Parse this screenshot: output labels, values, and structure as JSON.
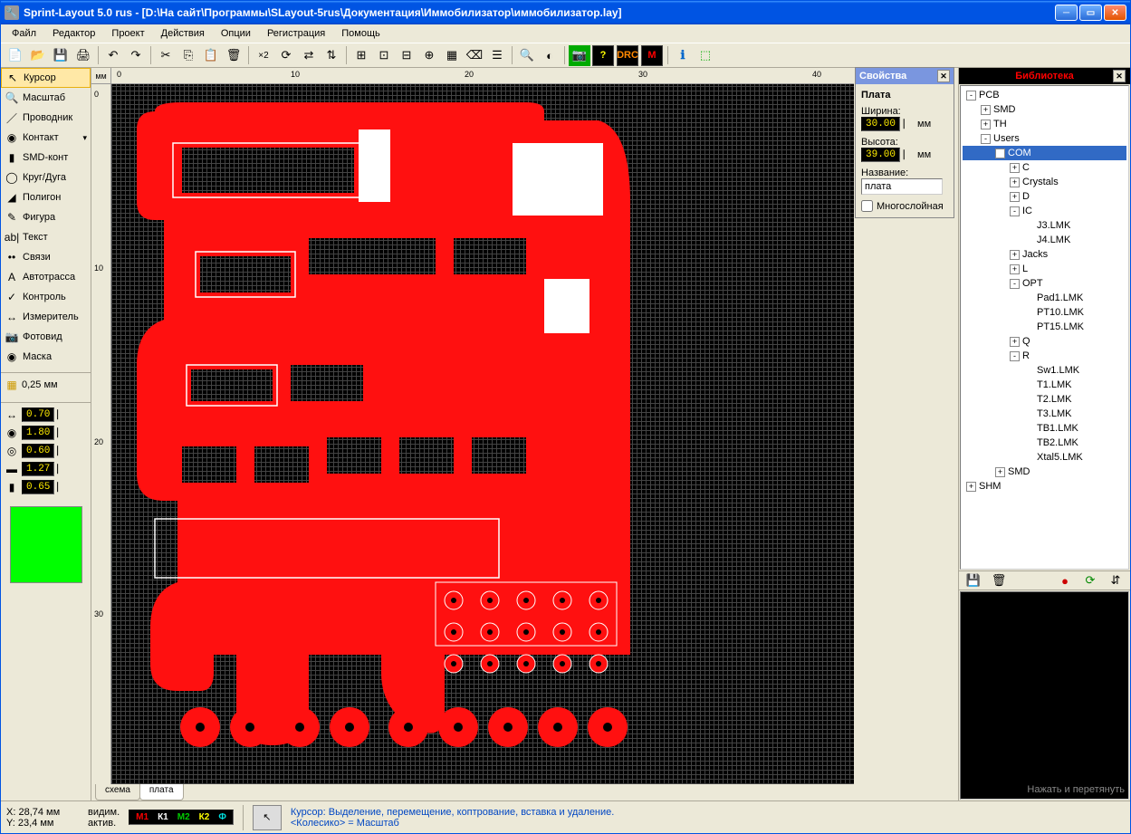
{
  "window": {
    "title": "Sprint-Layout 5.0 rus    - [D:\\На сайт\\Программы\\SLayout-5rus\\Документация\\Иммобилизатор\\иммобилизатор.lay]"
  },
  "menu": [
    "Файл",
    "Редактор",
    "Проект",
    "Действия",
    "Опции",
    "Регистрация",
    "Помощь"
  ],
  "tools": [
    {
      "icon": "↖",
      "label": "Курсор",
      "active": true
    },
    {
      "icon": "🔍",
      "label": "Масштаб"
    },
    {
      "icon": "／",
      "label": "Проводник"
    },
    {
      "icon": "◉",
      "label": "Контакт",
      "arrow": true
    },
    {
      "icon": "▮",
      "label": "SMD-конт"
    },
    {
      "icon": "◯",
      "label": "Круг/Дуга"
    },
    {
      "icon": "◢",
      "label": "Полигон"
    },
    {
      "icon": "✎",
      "label": "Фигура"
    },
    {
      "icon": "ab|",
      "label": "Текст"
    },
    {
      "icon": "••",
      "label": "Связи"
    },
    {
      "icon": "A",
      "label": "Автотрасса"
    },
    {
      "icon": "✓",
      "label": "Контроль"
    },
    {
      "icon": "↔",
      "label": "Измеритель"
    },
    {
      "icon": "📷",
      "label": "Фотовид"
    },
    {
      "icon": "◉",
      "label": "Маска"
    }
  ],
  "grid_label": "0,25 мм",
  "params": {
    "p1": "0.70",
    "p2": "1.80",
    "p3": "0.60",
    "p4": "1.27",
    "p5": "0.65"
  },
  "ruler_unit": "мм",
  "ruler_top": [
    "0",
    "10",
    "20",
    "30",
    "40"
  ],
  "ruler_left": [
    "0",
    "10",
    "20",
    "30"
  ],
  "tabs": [
    {
      "label": "схема"
    },
    {
      "label": "плата",
      "active": true
    }
  ],
  "props": {
    "title": "Свойства",
    "heading": "Плата",
    "width_label": "Ширина:",
    "width_val": "30.00",
    "unit": "мм",
    "height_label": "Высота:",
    "height_val": "39.00",
    "name_label": "Название:",
    "name_val": "плата",
    "multilayer": "Многослойная"
  },
  "lib": {
    "title": "Библиотека",
    "tree": [
      {
        "d": 0,
        "t": "-",
        "l": "PCB"
      },
      {
        "d": 1,
        "t": "+",
        "l": "SMD"
      },
      {
        "d": 1,
        "t": "+",
        "l": "TH"
      },
      {
        "d": 1,
        "t": "-",
        "l": "Users"
      },
      {
        "d": 2,
        "t": "-",
        "l": "COM",
        "sel": true
      },
      {
        "d": 3,
        "t": "+",
        "l": "C"
      },
      {
        "d": 3,
        "t": "+",
        "l": "Crystals"
      },
      {
        "d": 3,
        "t": "+",
        "l": "D"
      },
      {
        "d": 3,
        "t": "-",
        "l": "IC"
      },
      {
        "d": 4,
        "t": "",
        "l": "J3.LMK"
      },
      {
        "d": 4,
        "t": "",
        "l": "J4.LMK"
      },
      {
        "d": 3,
        "t": "+",
        "l": "Jacks"
      },
      {
        "d": 3,
        "t": "+",
        "l": "L"
      },
      {
        "d": 3,
        "t": "-",
        "l": "OPT"
      },
      {
        "d": 4,
        "t": "",
        "l": "Pad1.LMK"
      },
      {
        "d": 4,
        "t": "",
        "l": "PT10.LMK"
      },
      {
        "d": 4,
        "t": "",
        "l": "PT15.LMK"
      },
      {
        "d": 3,
        "t": "+",
        "l": "Q"
      },
      {
        "d": 3,
        "t": "-",
        "l": "R"
      },
      {
        "d": 4,
        "t": "",
        "l": "Sw1.LMK"
      },
      {
        "d": 4,
        "t": "",
        "l": "T1.LMK"
      },
      {
        "d": 4,
        "t": "",
        "l": "T2.LMK"
      },
      {
        "d": 4,
        "t": "",
        "l": "T3.LMK"
      },
      {
        "d": 4,
        "t": "",
        "l": "TB1.LMK"
      },
      {
        "d": 4,
        "t": "",
        "l": "TB2.LMK"
      },
      {
        "d": 4,
        "t": "",
        "l": "Xtal5.LMK"
      },
      {
        "d": 2,
        "t": "+",
        "l": "SMD"
      },
      {
        "d": 0,
        "t": "+",
        "l": "SHM"
      }
    ],
    "preview_hint": "Нажать и перетянуть"
  },
  "status": {
    "x_label": "X:",
    "x": "28,74 мм",
    "y_label": "Y:",
    "y": "23,4 мм",
    "vis": "видим.",
    "act": "актив.",
    "layers": [
      {
        "t": "М1",
        "c": "#ff0000"
      },
      {
        "t": "К1",
        "c": "#ffffff"
      },
      {
        "t": "М2",
        "c": "#00cc00"
      },
      {
        "t": "К2",
        "c": "#ffff00"
      },
      {
        "t": "Ф",
        "c": "#00e0e0"
      }
    ],
    "hint1": "Курсор: Выделение, перемещение, коптрование, вставка и удаление.",
    "hint2": "<Колесико> = Масштаб"
  }
}
